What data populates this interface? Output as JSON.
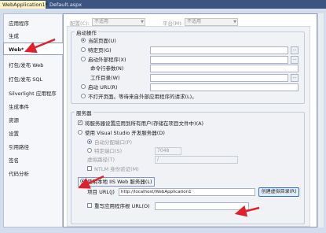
{
  "tabs": [
    {
      "label": "WebApplication1*",
      "close": "×"
    },
    {
      "label": "Default.aspx"
    }
  ],
  "sidebar": {
    "items": [
      {
        "label": "应用程序"
      },
      {
        "label": "生成"
      },
      {
        "label": "Web*"
      },
      {
        "label": "打包/发布 Web"
      },
      {
        "label": "打包/发布 SQL"
      },
      {
        "label": "Silverlight 应用程序"
      },
      {
        "label": "生成事件"
      },
      {
        "label": "资源"
      },
      {
        "label": "设置"
      },
      {
        "label": "引用路径"
      },
      {
        "label": "签名"
      },
      {
        "label": "代码分析"
      }
    ],
    "active_index": 2
  },
  "config": {
    "config_label": "配置(C):",
    "config_value": "不适用",
    "platform_label": "平台(M):",
    "platform_value": "不适用"
  },
  "start_action": {
    "title": "启动操作",
    "current_page": "当前页面(U)",
    "specific_page": "特定页(G)",
    "start_external": "启动外部程序(X)",
    "cmd_args": "命令行参数(N)",
    "working_dir": "工作目录(W)",
    "start_url": "启动 URL(R)",
    "no_open": "不打开页面。等待来自外部应用程序的请求(L)。",
    "browse_label": "..."
  },
  "servers": {
    "title": "服务器",
    "apply_all": "将服务器设置应用到所有用户(存储在项目文件中)(A)",
    "use_vs_dev": "使用 Visual Studio 开发服务器(D)",
    "auto_port": "自动分配端口(P)",
    "specific_port": "特定端口(S)",
    "port_value": "7048",
    "virtual_path": "虚拟路径(T)",
    "virtual_path_value": "/",
    "ntlm": "NTLM 身份验证(M)",
    "use_iis": "使用本地 IIS Web 服务器(L)",
    "project_url_label": "项目 URL(J)",
    "project_url_value": "http://localhost/WebApplication1",
    "create_vdir": "创建虚拟目录(R)",
    "override_root": "重写应用程序根 URL(O)"
  },
  "colors": {
    "accent_arrow": "#e0202b",
    "tab_bar": "#3c5580",
    "active_tab": "#fdf3c2"
  }
}
